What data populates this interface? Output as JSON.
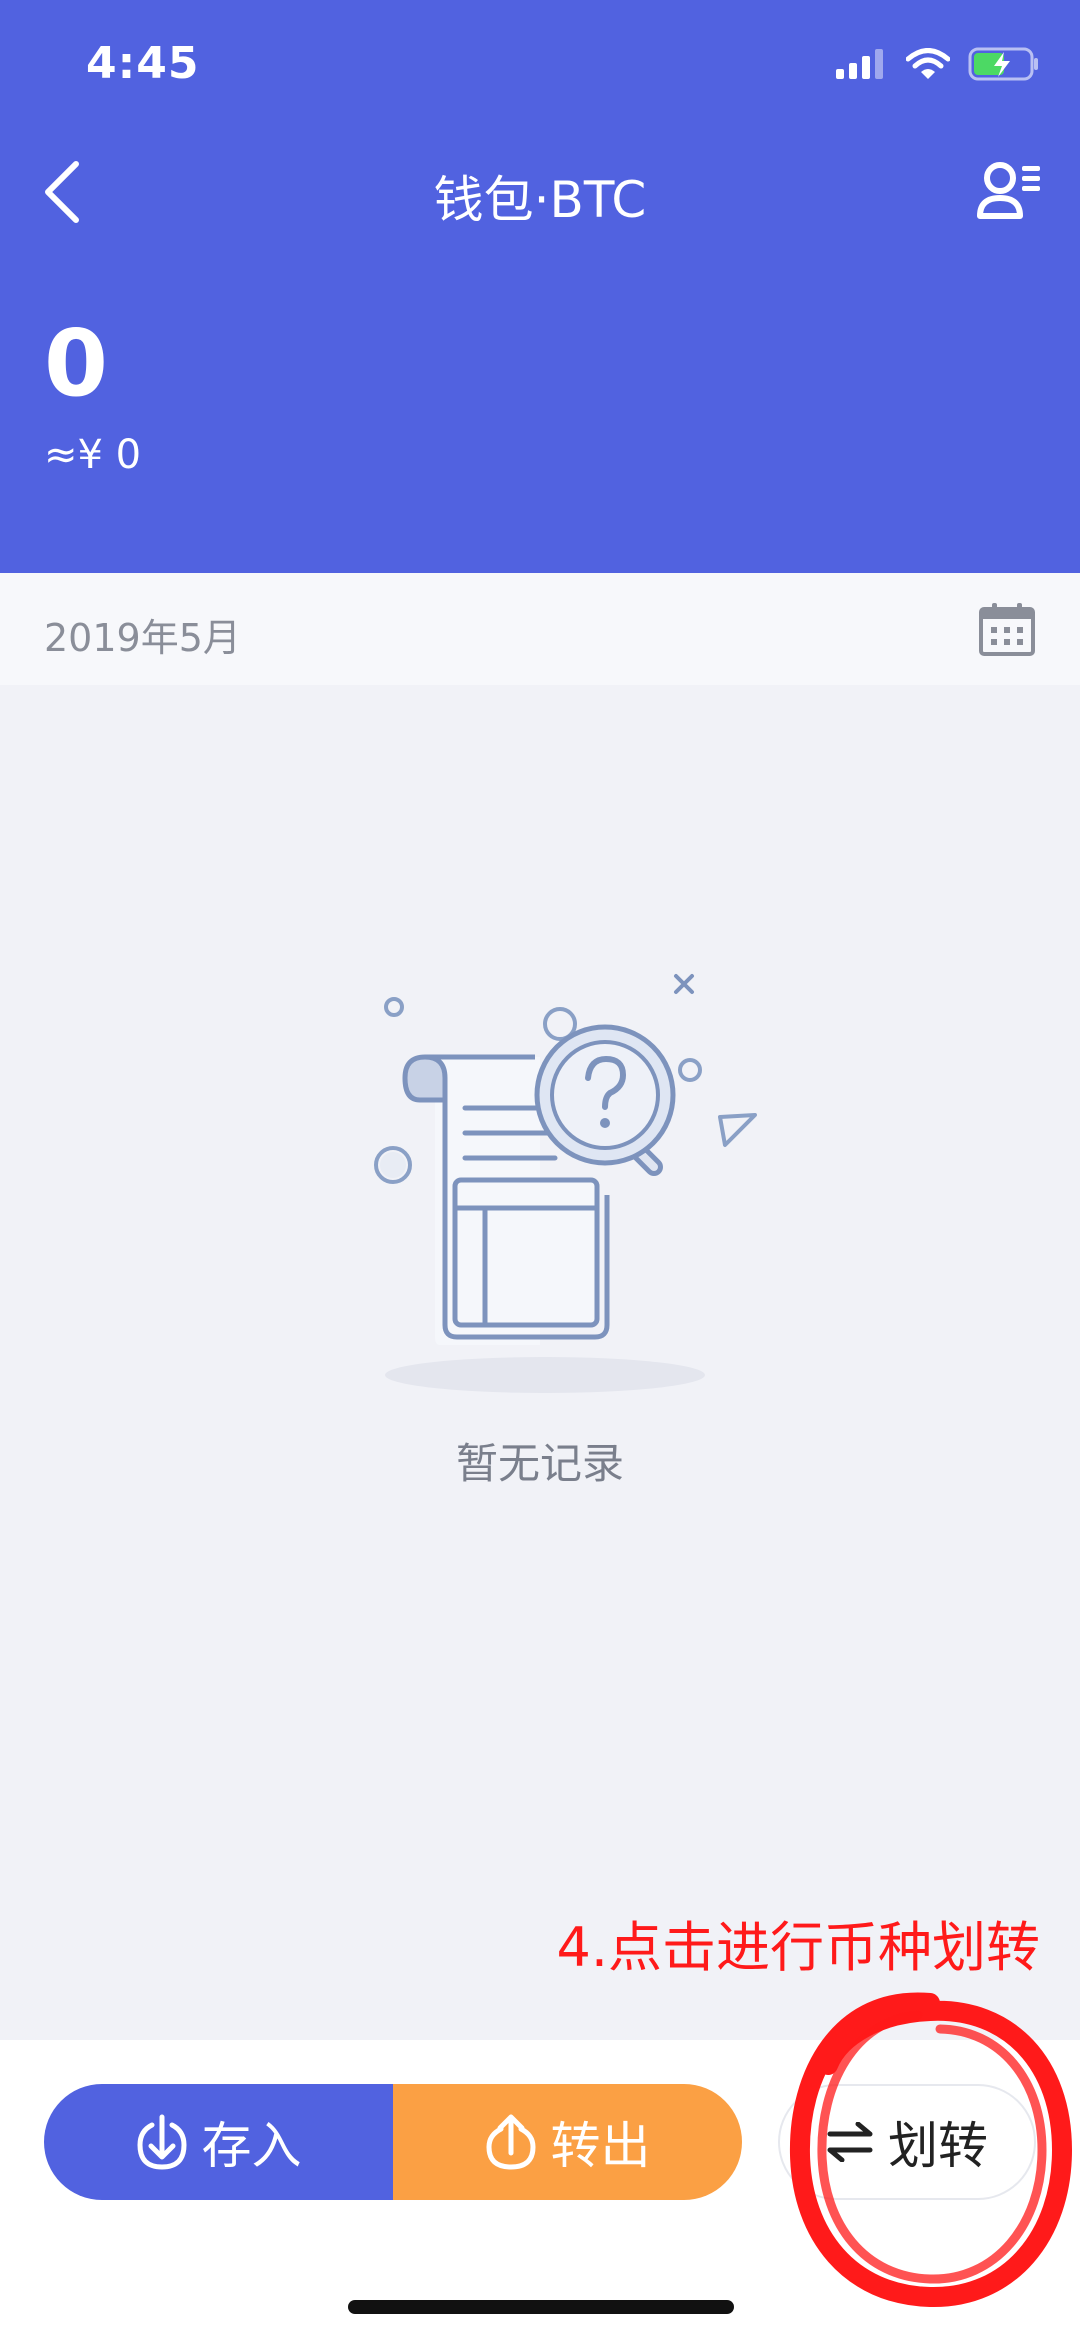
{
  "status_bar": {
    "time": "4:45"
  },
  "nav": {
    "title": "钱包·BTC"
  },
  "wallet": {
    "balance": "0",
    "balance_cny": "≈¥ 0"
  },
  "filter": {
    "date": "2019年5月"
  },
  "empty_state": {
    "message": "暂无记录"
  },
  "annotation": {
    "text": "4.点击进行币种划转"
  },
  "actions": {
    "deposit": "存入",
    "withdraw": "转出",
    "transfer": "划转"
  },
  "colors": {
    "primary": "#5162e0",
    "withdraw": "#fba044",
    "annotation": "#ff1a1a"
  }
}
